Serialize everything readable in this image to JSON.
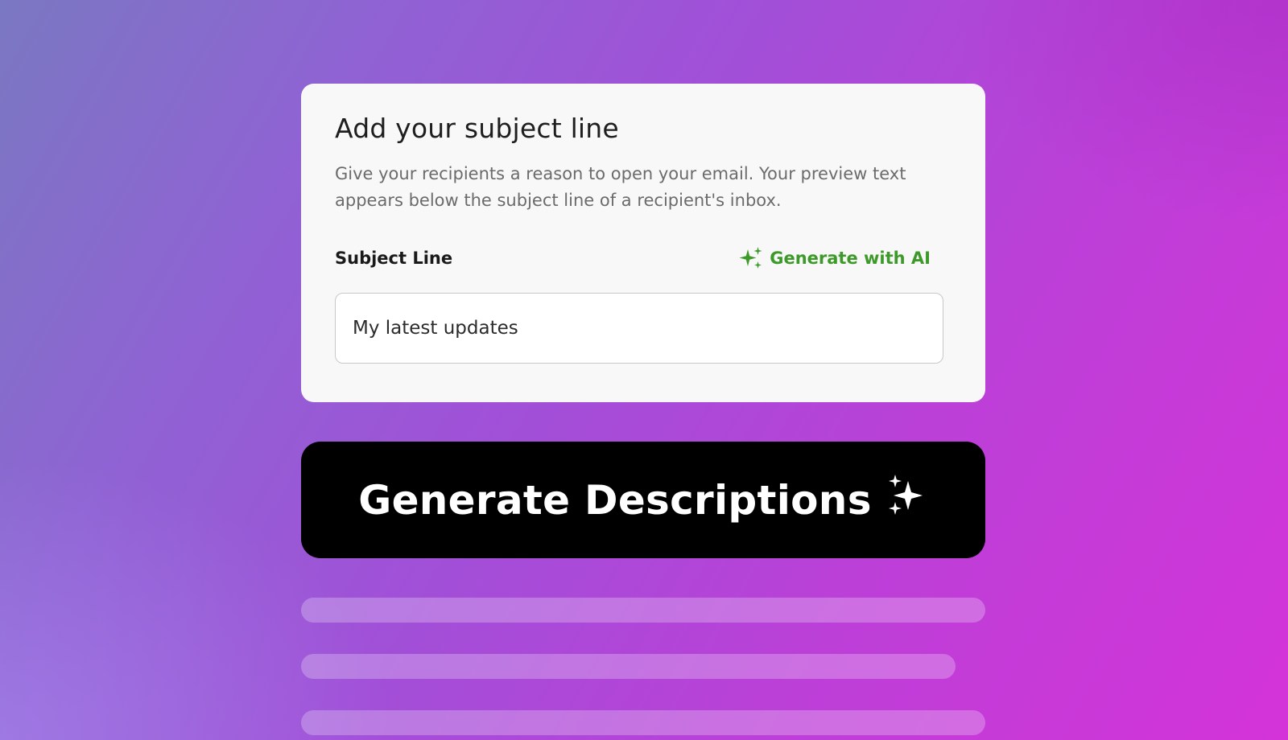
{
  "card": {
    "title": "Add your subject line",
    "description": "Give your recipients a reason to open your email. Your preview text appears below the subject line of a recipient's inbox.",
    "field_label": "Subject Line",
    "ai_link_label": "Generate with AI",
    "ai_link_icon": "sparkles-icon",
    "input_value": "My latest updates"
  },
  "main_button": {
    "label": "Generate Descriptions",
    "icon": "sparkles-icon"
  },
  "colors": {
    "accent_green": "#3d9a2a",
    "button_bg": "#000000",
    "card_bg": "#f8f8f8"
  }
}
